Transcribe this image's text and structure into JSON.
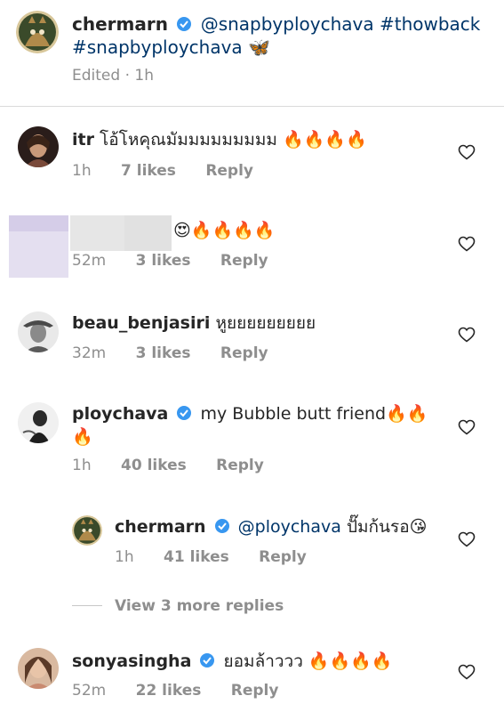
{
  "caption": {
    "username": "chermarn",
    "mention": "@snapbyploychava",
    "hashtags": [
      "#thowback",
      "#snapbyploychava"
    ],
    "emoji": "🦋",
    "meta": "Edited · 1h"
  },
  "comments": [
    {
      "username": "itr",
      "text": "โอ้โหคุณมัมมมมมมมมม 🔥🔥🔥🔥",
      "time": "1h",
      "likes": "7 likes",
      "reply": "Reply"
    },
    {
      "username": "",
      "text": "😍🔥🔥🔥🔥",
      "time": "52m",
      "likes": "3 likes",
      "reply": "Reply"
    },
    {
      "username": "beau_benjasiri",
      "text": "หูยยยยยยยยย",
      "time": "32m",
      "likes": "3 likes",
      "reply": "Reply"
    },
    {
      "username": "ploychava",
      "text": "my Bubble butt friend🔥🔥",
      "text2": "🔥",
      "time": "1h",
      "likes": "40 likes",
      "reply": "Reply"
    },
    {
      "username": "chermarn",
      "mention": "@ploychava",
      "text": "ปั๊มก้นรอ😘",
      "time": "1h",
      "likes": "41 likes",
      "reply": "Reply"
    },
    {
      "username": "sonyasingha",
      "text": "ยอมล้าววว 🔥🔥🔥🔥",
      "time": "52m",
      "likes": "22 likes",
      "reply": "Reply"
    }
  ],
  "view_more": "View 3 more replies",
  "icons": {
    "heart": "heart-outline-icon",
    "verified": "verified-badge-icon"
  },
  "colors": {
    "verified": "#3897f0",
    "link": "#003569",
    "meta": "#8e8e8e"
  }
}
